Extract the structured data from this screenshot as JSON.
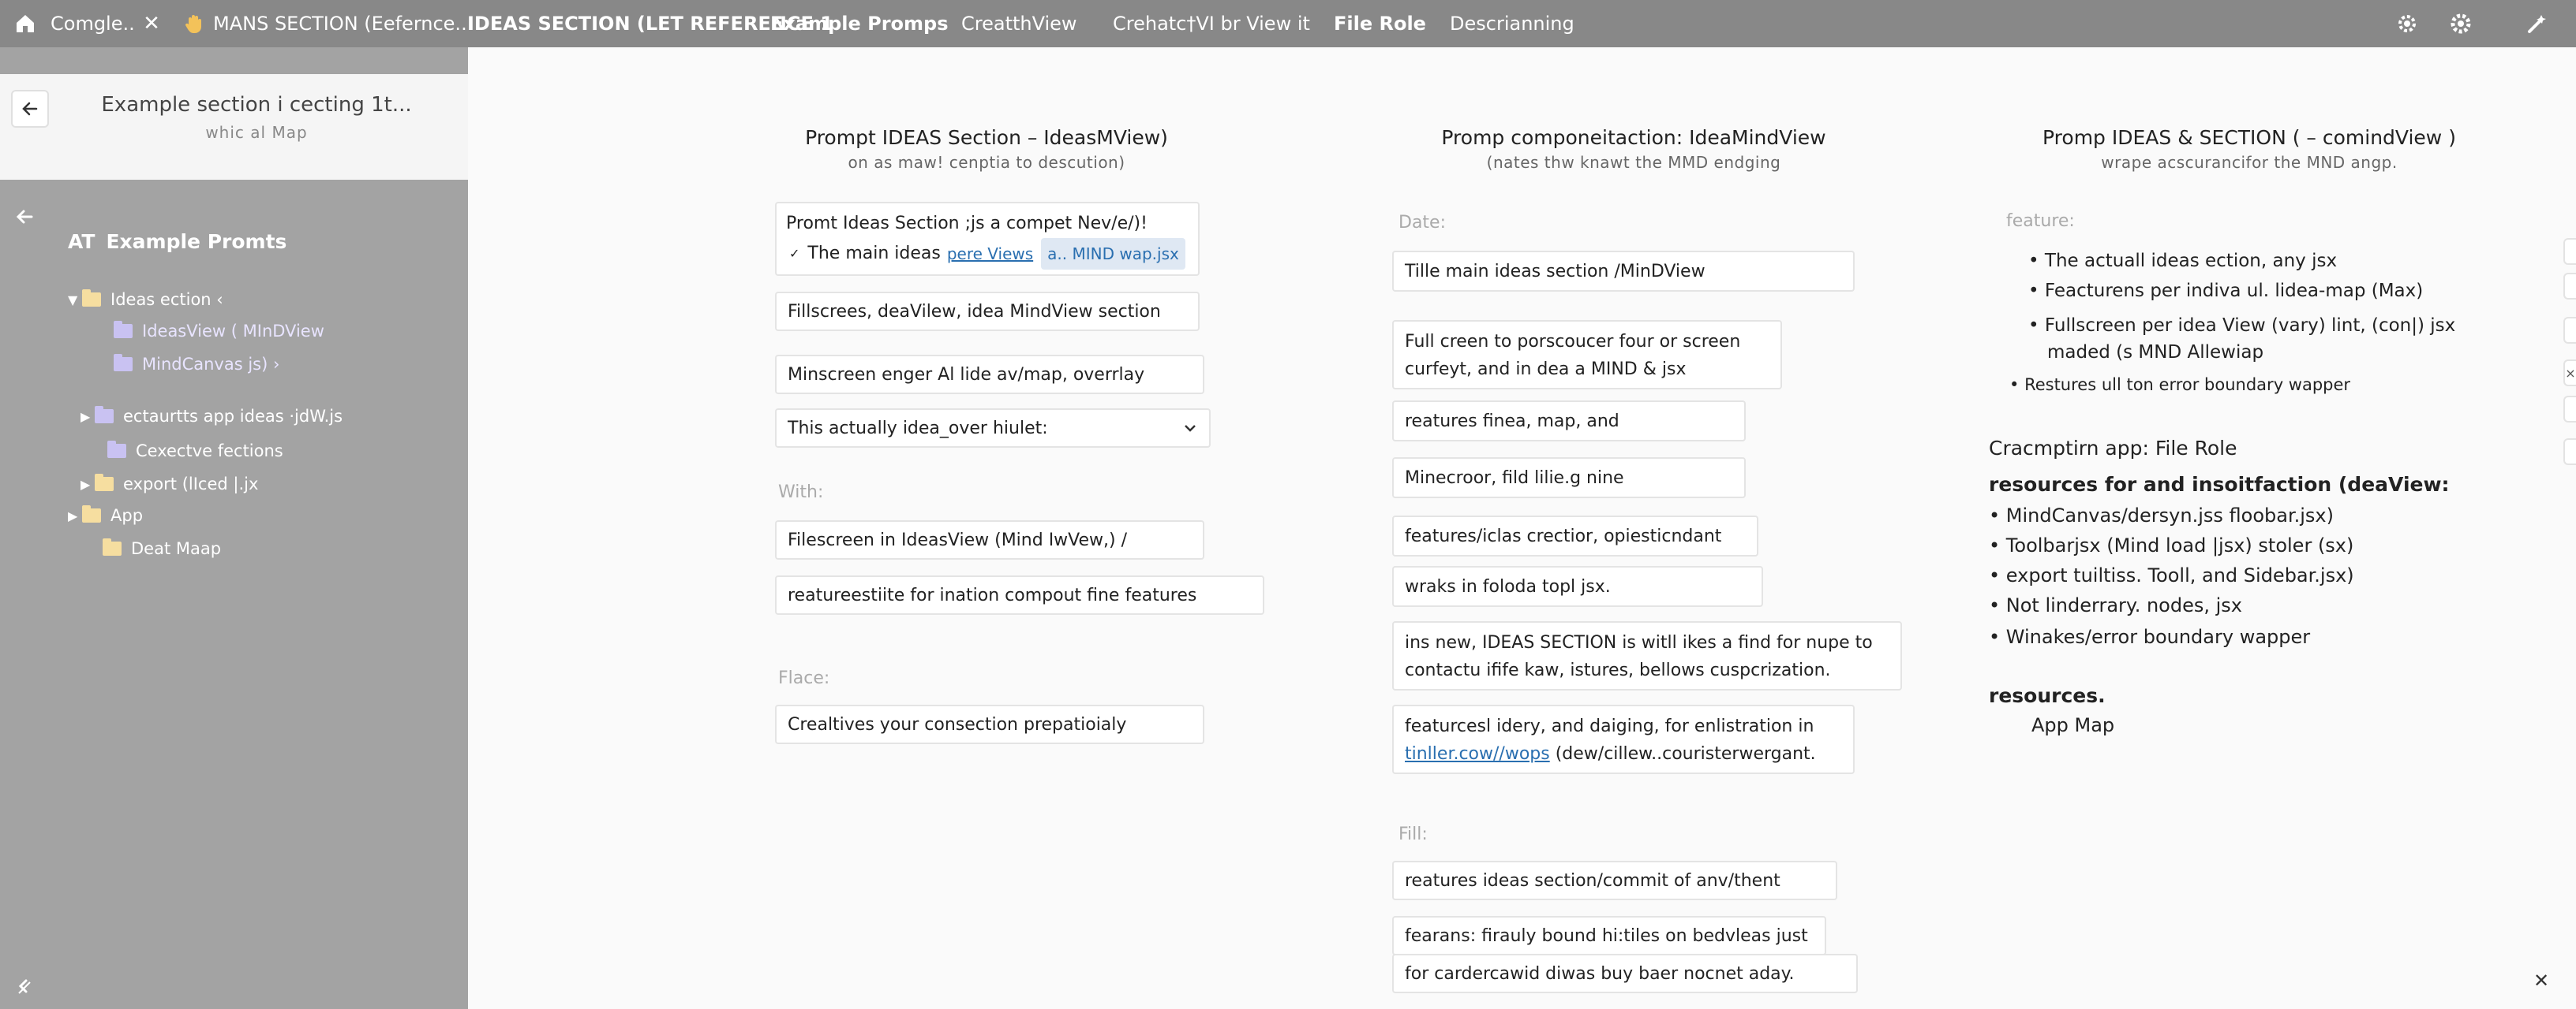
{
  "topbar": {
    "tabs": [
      {
        "label": "Comgle.."
      },
      {
        "label": "MANS SECTION (Eefernce.."
      },
      {
        "label": "IDEAS SECTION (LET REFERENCE 1"
      },
      {
        "label": "Example Promps"
      },
      {
        "label": "CreatthView"
      },
      {
        "label": "Crehatc†VI br View it"
      },
      {
        "label": "File Role"
      },
      {
        "label": "Descrianning"
      }
    ],
    "close_symbol": "✕"
  },
  "sidebar": {
    "header_title": "Example section i cecting 1t...",
    "header_subtitle": "whic al Map",
    "section_prefix": "AT",
    "section_title": "Example Promts",
    "tree": [
      {
        "label": "Ideas ection ‹",
        "icon": "folder"
      },
      {
        "label": "IdeasView ( MInDView",
        "icon": "folder-blue"
      },
      {
        "label": "MindCanvas js) ›",
        "icon": "folder-blue"
      },
      {
        "label": "ectaurtts app ideas ·jdW.js",
        "icon": "folder-blue"
      },
      {
        "label": "Cexectve fections",
        "icon": "folder-blue"
      },
      {
        "label": "export (lIced |.jx",
        "icon": "folder"
      },
      {
        "label": "App",
        "icon": "folder"
      },
      {
        "label": "Deat Maap",
        "icon": "folder"
      }
    ]
  },
  "col1": {
    "title": "Prompt IDEAS Section – IdeasMView)",
    "subtitle": "on as maw! cenptia to descution)",
    "card_line1": "Promt Ideas Section ;js a compet Nev/e/)!",
    "card_line2_prefix": "The main ideas",
    "card_link": "pere Views",
    "card_chip": "a.. MIND wap.jsx",
    "field1": "Fillscrees, deaVilew, idea MindView section",
    "field2": "Minscreen enger Al lide av/map, overrlay",
    "select_value": "This actually idea_over hiulet:",
    "label_with": "With:",
    "field3": "Filescreen in IdeasView (Mind IwVew,) /",
    "field4": "reatureestiite for ination compout fine features",
    "label_flace": "Flace:",
    "field5": "Crealtives your consection prepatioialy"
  },
  "col2": {
    "title": "Promp componeitaction: IdeaMindView",
    "subtitle": "(nates thw knawt the MMD endging",
    "label_date": "Date:",
    "field1": "Tille main ideas section /MinDView",
    "field2_line1": "Full creen to porscoucer four or screen",
    "field2_line2": "curfeyt, and in dea a MIND & jsx",
    "field3": "reatures finea, map, and",
    "field4": "Minecroor, fild lilie.g nine",
    "field5": "features/iclas crectior, opiesticndant",
    "field6": "wraks in foloda topl jsx.",
    "field7_line1": "ins new, IDEAS SECTION is witll ikes a find for nupe to",
    "field7_line2": "contactu ifife kaw, istures, bellows cuspcrization.",
    "field8_line1": "featurcesl idery, and daiging, for enlistration in",
    "field8_link": "tinller.cow//wops",
    "field8_line2_rest": " (dew/cillew..couristerwergant.",
    "label_fill": "Fill:",
    "field9": "reatures ideas section/commit of anv/thent",
    "field10": "fearans: firauly bound hi:tiles on bedvleas just",
    "field11": "for cardercawid diwas buy baer nocnet aday."
  },
  "col3": {
    "title": "Promp IDEAS & SECTION ( – comindView )",
    "subtitle": "wrape acscurancifor the MND angp.",
    "label_feature": "feature:",
    "bullets": [
      "The actuall ideas ection, any jsx",
      "Feacturens per indiva ul. lidea-map (Max)",
      "Fullscreen per idea View (vary) lint, (con|) jsx",
      "maded (s MND Allewiap",
      "Restures ull ton error boundary wapper"
    ],
    "heading": "Cracmptirn app: File Role",
    "intro": "resources for and insoitfaction (deaView:",
    "list": [
      "MindCanvas/dersyn.jss floobar.jsx)",
      "Toolbarjsx (Mind load |jsx) stoler (sx)",
      "export tuiltiss. Tooll, and Sidebar.jsx)",
      "Not linderrary. nodes, jsx",
      "Winakes/error boundary wapper"
    ],
    "footer_label": "resources.",
    "footer_value": "App Map"
  }
}
